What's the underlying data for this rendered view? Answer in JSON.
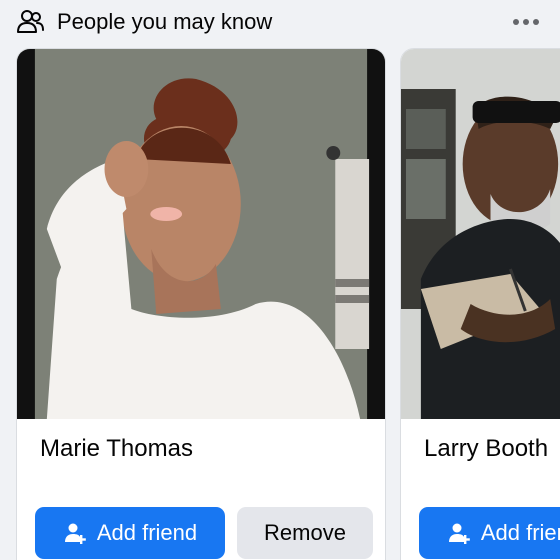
{
  "section": {
    "title": "People you may know",
    "icon": "people-icon",
    "more_icon": "more-options-icon"
  },
  "suggestions": [
    {
      "name": "Marie Thomas",
      "add_label": "Add friend",
      "remove_label": "Remove",
      "photo": "profile-photo"
    },
    {
      "name": "Larry Booth",
      "add_label": "Add friend",
      "photo": "profile-photo"
    }
  ],
  "colors": {
    "accent": "#1877f2",
    "secondary_button": "#e4e6eb",
    "text": "#050505",
    "icon_gray": "#65676b"
  }
}
